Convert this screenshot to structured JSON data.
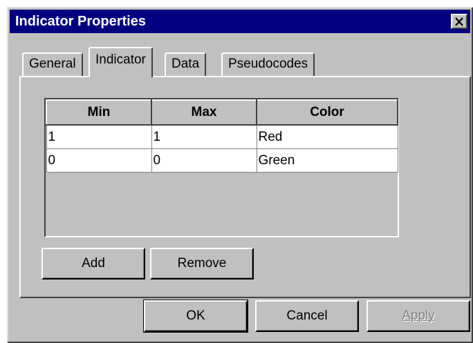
{
  "window": {
    "title": "Indicator Properties",
    "close_label": "close"
  },
  "tabs": [
    {
      "label": "General",
      "active": false
    },
    {
      "label": "Indicator",
      "active": true
    },
    {
      "label": "Data",
      "active": false
    },
    {
      "label": "Pseudocodes",
      "active": false
    }
  ],
  "grid": {
    "columns": [
      "Min",
      "Max",
      "Color"
    ],
    "rows": [
      {
        "min": "1",
        "max": "1",
        "color": "Red"
      },
      {
        "min": "0",
        "max": "0",
        "color": "Green"
      }
    ]
  },
  "panel_buttons": {
    "add": "Add",
    "remove": "Remove"
  },
  "dialog_buttons": {
    "ok": "OK",
    "cancel": "Cancel",
    "apply": "Apply"
  },
  "colors": {
    "titlebar": "#000080",
    "face": "#c0c0c0"
  }
}
